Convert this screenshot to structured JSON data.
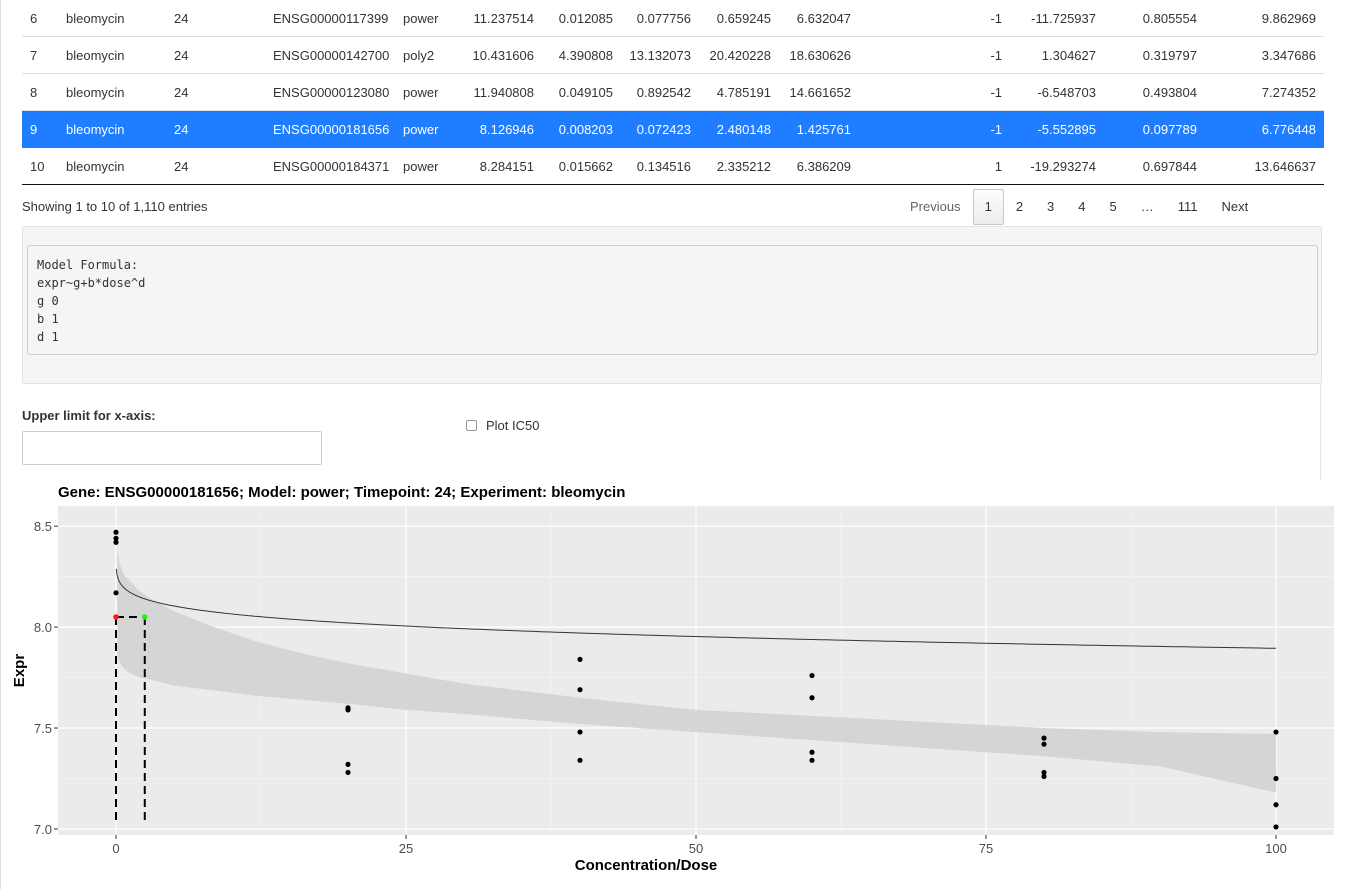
{
  "table": {
    "rows": [
      {
        "id": "6",
        "experiment": "bleomycin",
        "timepoint": "24",
        "gene": "ENSG00000117399",
        "model": "power",
        "c1": "11.237514",
        "c2": "0.012085",
        "c3": "0.077756",
        "c4": "0.659245",
        "c5": "6.632047",
        "c6": "",
        "c7": "-1",
        "c8": "-11.725937",
        "c9": "0.805554",
        "c10": "9.862969",
        "selected": false
      },
      {
        "id": "7",
        "experiment": "bleomycin",
        "timepoint": "24",
        "gene": "ENSG00000142700",
        "model": "poly2",
        "c1": "10.431606",
        "c2": "4.390808",
        "c3": "13.132073",
        "c4": "20.420228",
        "c5": "18.630626",
        "c6": "",
        "c7": "-1",
        "c8": "1.304627",
        "c9": "0.319797",
        "c10": "3.347686",
        "selected": false
      },
      {
        "id": "8",
        "experiment": "bleomycin",
        "timepoint": "24",
        "gene": "ENSG00000123080",
        "model": "power",
        "c1": "11.940808",
        "c2": "0.049105",
        "c3": "0.892542",
        "c4": "4.785191",
        "c5": "14.661652",
        "c6": "",
        "c7": "-1",
        "c8": "-6.548703",
        "c9": "0.493804",
        "c10": "7.274352",
        "selected": false
      },
      {
        "id": "9",
        "experiment": "bleomycin",
        "timepoint": "24",
        "gene": "ENSG00000181656",
        "model": "power",
        "c1": "8.126946",
        "c2": "0.008203",
        "c3": "0.072423",
        "c4": "2.480148",
        "c5": "1.425761",
        "c6": "",
        "c7": "-1",
        "c8": "-5.552895",
        "c9": "0.097789",
        "c10": "6.776448",
        "selected": true
      },
      {
        "id": "10",
        "experiment": "bleomycin",
        "timepoint": "24",
        "gene": "ENSG00000184371",
        "model": "power",
        "c1": "8.284151",
        "c2": "0.015662",
        "c3": "0.134516",
        "c4": "2.335212",
        "c5": "6.386209",
        "c6": "",
        "c7": "1",
        "c8": "-19.293274",
        "c9": "0.697844",
        "c10": "13.646637",
        "selected": false
      }
    ],
    "selected_color": "#1f7dff"
  },
  "table_info": "Showing 1 to 10 of 1,110 entries",
  "pagination": {
    "previous": "Previous",
    "pages": [
      "1",
      "2",
      "3",
      "4",
      "5",
      "…",
      "111"
    ],
    "current": "1",
    "next": "Next"
  },
  "formula": {
    "lines": [
      "Model Formula:",
      "expr~g+b*dose^d",
      "g 0",
      "b 1",
      "d 1"
    ]
  },
  "controls": {
    "xaxis_label": "Upper limit for x-axis:",
    "xaxis_value": "",
    "ic50_label": "Plot IC50",
    "ic50_checked": false
  },
  "chart_data": {
    "type": "scatter",
    "title": "Gene: ENSG00000181656; Model: power; Timepoint: 24; Experiment: bleomycin",
    "xlabel": "Concentration/Dose",
    "ylabel": "Expr",
    "xlim": [
      -5,
      105
    ],
    "ylim": [
      6.97,
      8.6
    ],
    "xticks": [
      0,
      25,
      50,
      75,
      100
    ],
    "xtick_labels": [
      "0",
      "25",
      "50",
      "75",
      "100"
    ],
    "yticks": [
      7.0,
      7.5,
      8.0,
      8.5
    ],
    "ytick_labels": [
      "7.0",
      "7.5",
      "8.0",
      "8.5"
    ],
    "grid": true,
    "panel_background": "#ebebeb",
    "points": {
      "x": [
        0,
        0,
        0,
        0,
        20,
        20,
        20,
        20,
        40,
        40,
        40,
        40,
        60,
        60,
        60,
        60,
        80,
        80,
        80,
        80,
        100,
        100,
        100,
        100
      ],
      "y": [
        8.47,
        8.44,
        8.42,
        8.17,
        7.6,
        7.59,
        7.32,
        7.28,
        7.84,
        7.69,
        7.48,
        7.34,
        7.76,
        7.65,
        7.38,
        7.34,
        7.45,
        7.42,
        7.28,
        7.26,
        7.48,
        7.25,
        7.12,
        7.01
      ]
    },
    "fit": {
      "g": 8.126946,
      "b": -5.552895,
      "d": 0.097789,
      "line_color": "#333333"
    },
    "band": {
      "x": [
        0.1,
        0.3,
        0.6,
        1,
        2,
        3,
        5,
        8,
        12,
        16,
        20,
        25,
        30,
        40,
        50,
        60,
        70,
        80,
        90,
        100
      ],
      "lower": [
        7.86,
        7.83,
        7.8,
        7.78,
        7.75,
        7.74,
        7.71,
        7.69,
        7.66,
        7.64,
        7.62,
        7.59,
        7.57,
        7.52,
        7.48,
        7.44,
        7.4,
        7.36,
        7.31,
        7.18
      ],
      "upper": [
        8.4,
        8.32,
        8.27,
        8.24,
        8.18,
        8.14,
        8.08,
        8.01,
        7.93,
        7.87,
        7.82,
        7.77,
        7.72,
        7.65,
        7.59,
        7.56,
        7.53,
        7.5,
        7.48,
        7.47
      ],
      "color": "#d3d3d3"
    },
    "ic50_markers": [
      {
        "x": 0,
        "y": 8.05,
        "color": "#ff1a1a"
      },
      {
        "x": 2.48,
        "y": 8.05,
        "color": "#22ee22"
      }
    ]
  }
}
